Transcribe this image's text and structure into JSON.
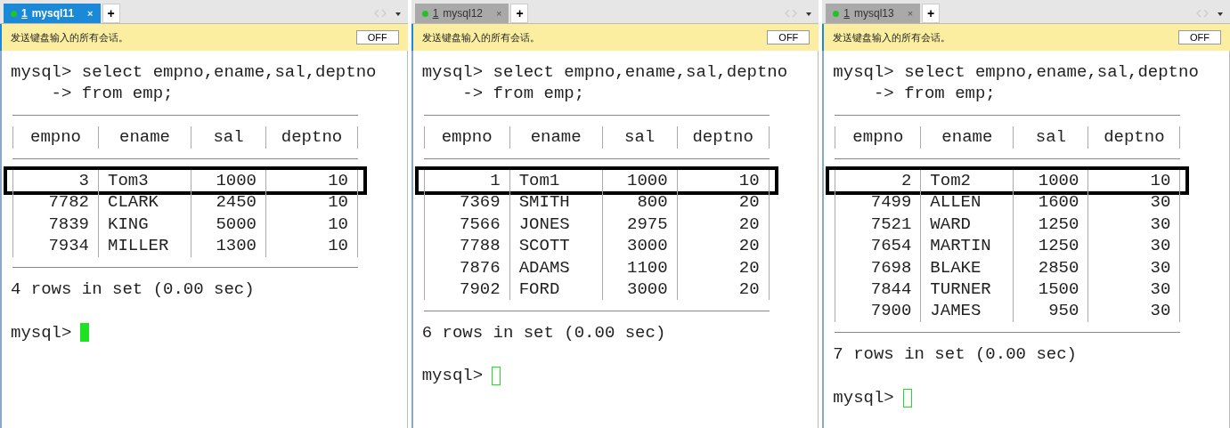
{
  "panes": [
    {
      "tab": {
        "number": "1",
        "title": "mysql11",
        "close": "×",
        "selected": true
      },
      "new_tab": "+",
      "broadcast": {
        "message": "发送键盘输入的所有会话。",
        "button": "OFF"
      },
      "command": [
        "mysql> select empno,ename,sal,deptno",
        "    -> from emp;"
      ],
      "table": {
        "columns": [
          "empno",
          "ename",
          "sal",
          "deptno"
        ],
        "rows": [
          {
            "cells": [
              "3",
              "Tom3",
              "1000",
              "10"
            ],
            "highlighted": true
          },
          {
            "cells": [
              "7782",
              "CLARK",
              "2450",
              "10"
            ],
            "highlighted": false
          },
          {
            "cells": [
              "7839",
              "KING",
              "5000",
              "10"
            ],
            "highlighted": false
          },
          {
            "cells": [
              "7934",
              "MILLER",
              "1300",
              "10"
            ],
            "highlighted": false
          }
        ]
      },
      "result": "4 rows in set (0.00 sec)",
      "prompt": "mysql>",
      "cursor_focused": true
    },
    {
      "tab": {
        "number": "1",
        "title": "mysql12",
        "close": "×",
        "selected": false
      },
      "new_tab": "+",
      "broadcast": {
        "message": "发送键盘输入的所有会话。",
        "button": "OFF"
      },
      "command": [
        "mysql> select empno,ename,sal,deptno",
        "    -> from emp;"
      ],
      "table": {
        "columns": [
          "empno",
          "ename",
          "sal",
          "deptno"
        ],
        "rows": [
          {
            "cells": [
              "1",
              "Tom1",
              "1000",
              "10"
            ],
            "highlighted": true
          },
          {
            "cells": [
              "7369",
              "SMITH",
              "800",
              "20"
            ],
            "highlighted": false
          },
          {
            "cells": [
              "7566",
              "JONES",
              "2975",
              "20"
            ],
            "highlighted": false
          },
          {
            "cells": [
              "7788",
              "SCOTT",
              "3000",
              "20"
            ],
            "highlighted": false
          },
          {
            "cells": [
              "7876",
              "ADAMS",
              "1100",
              "20"
            ],
            "highlighted": false
          },
          {
            "cells": [
              "7902",
              "FORD",
              "3000",
              "20"
            ],
            "highlighted": false
          }
        ]
      },
      "result": "6 rows in set (0.00 sec)",
      "prompt": "mysql>",
      "cursor_focused": false
    },
    {
      "tab": {
        "number": "1",
        "title": "mysql13",
        "close": "×",
        "selected": false
      },
      "new_tab": "+",
      "broadcast": {
        "message": "发送键盘输入的所有会话。",
        "button": "OFF"
      },
      "command": [
        "mysql> select empno,ename,sal,deptno",
        "    -> from emp;"
      ],
      "table": {
        "columns": [
          "empno",
          "ename",
          "sal",
          "deptno"
        ],
        "rows": [
          {
            "cells": [
              "2",
              "Tom2",
              "1000",
              "10"
            ],
            "highlighted": true
          },
          {
            "cells": [
              "7499",
              "ALLEN",
              "1600",
              "30"
            ],
            "highlighted": false
          },
          {
            "cells": [
              "7521",
              "WARD",
              "1250",
              "30"
            ],
            "highlighted": false
          },
          {
            "cells": [
              "7654",
              "MARTIN",
              "1250",
              "30"
            ],
            "highlighted": false
          },
          {
            "cells": [
              "7698",
              "BLAKE",
              "2850",
              "30"
            ],
            "highlighted": false
          },
          {
            "cells": [
              "7844",
              "TURNER",
              "1500",
              "30"
            ],
            "highlighted": false
          },
          {
            "cells": [
              "7900",
              "JAMES",
              "950",
              "30"
            ],
            "highlighted": false
          }
        ]
      },
      "result": "7 rows in set (0.00 sec)",
      "prompt": "mysql>",
      "cursor_focused": false
    }
  ]
}
